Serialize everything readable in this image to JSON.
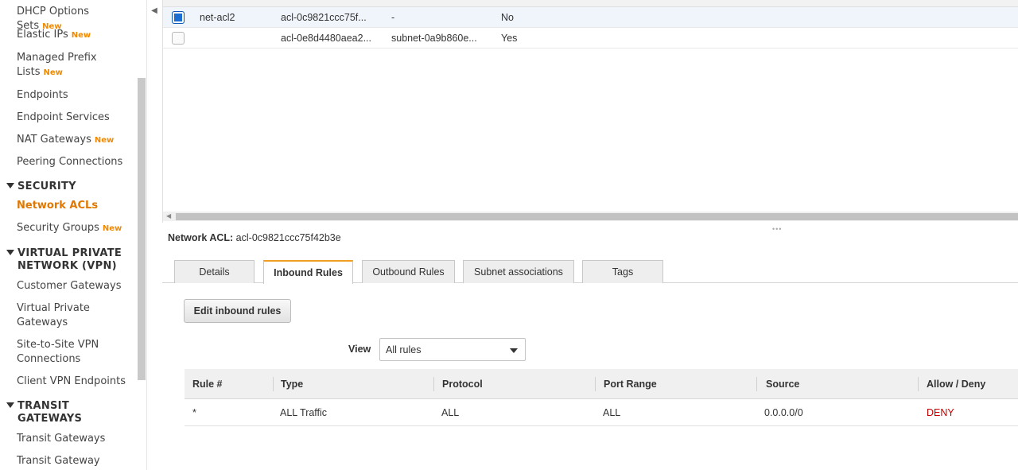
{
  "sidebar": {
    "items": [
      {
        "label": "DHCP Options Sets",
        "badge": "New"
      },
      {
        "label": "Elastic IPs",
        "badge": "New"
      },
      {
        "label": "Managed Prefix",
        "label2": "Lists",
        "badge": "New"
      },
      {
        "label": "Endpoints"
      },
      {
        "label": "Endpoint Services"
      },
      {
        "label": "NAT Gateways",
        "badge": "New"
      },
      {
        "label": "Peering Connections"
      }
    ],
    "security": {
      "header": "SECURITY",
      "items": [
        {
          "label": "Network ACLs"
        },
        {
          "label": "Security Groups",
          "badge": "New"
        }
      ]
    },
    "vpn": {
      "header_line1": "VIRTUAL PRIVATE",
      "header_line2": "NETWORK (VPN)",
      "items": [
        {
          "label": "Customer Gateways"
        },
        {
          "label": "Virtual Private",
          "label2": "Gateways"
        },
        {
          "label": "Site-to-Site VPN",
          "label2": "Connections"
        },
        {
          "label": "Client VPN Endpoints"
        }
      ]
    },
    "transit": {
      "header_line1": "TRANSIT",
      "header_line2": "GATEWAYS",
      "items": [
        {
          "label": "Transit Gateways"
        },
        {
          "label": "Transit Gateway"
        }
      ]
    }
  },
  "acl_table": {
    "rows": [
      {
        "name": "net-acl2",
        "id": "acl-0c9821ccc75f...",
        "associated": "-",
        "default": "No",
        "selected": true
      },
      {
        "name": "",
        "id": "acl-0e8d4480aea2...",
        "associated": "subnet-0a9b860e...",
        "default": "Yes",
        "selected": false
      }
    ]
  },
  "details": {
    "label": "Network ACL:",
    "acl_id": "acl-0c9821ccc75f42b3e",
    "tabs": [
      "Details",
      "Inbound Rules",
      "Outbound Rules",
      "Subnet associations",
      "Tags"
    ],
    "active_tab": "Inbound Rules",
    "edit_button": "Edit inbound rules",
    "view_label": "View",
    "view_value": "All rules",
    "rules_headers": [
      "Rule #",
      "Type",
      "Protocol",
      "Port Range",
      "Source",
      "Allow / Deny"
    ],
    "rules": [
      {
        "rule": "*",
        "type": "ALL Traffic",
        "protocol": "ALL",
        "port_range": "ALL",
        "source": "0.0.0.0/0",
        "action": "DENY"
      }
    ]
  },
  "colors": {
    "accent_orange": "#e07800",
    "deny_red": "#c40000",
    "checkbox_blue": "#1c6ed1"
  }
}
